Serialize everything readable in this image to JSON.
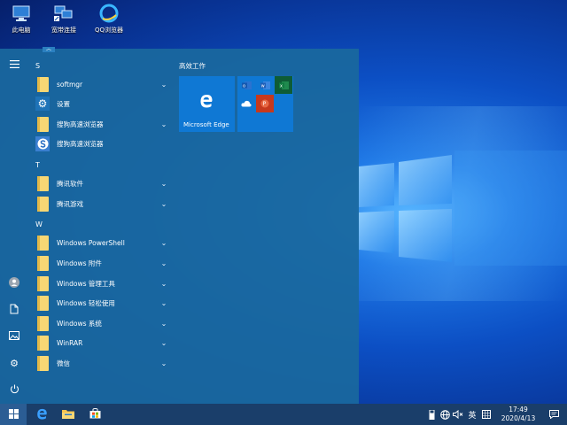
{
  "desktop": {
    "icons": [
      {
        "label": "此电脑",
        "icon": "computer-icon"
      },
      {
        "label": "宽带连接",
        "icon": "network-connection-icon"
      },
      {
        "label": "QQ浏览器",
        "icon": "qq-browser-icon"
      }
    ]
  },
  "start_menu": {
    "groups": [
      {
        "letter": "S",
        "apps": [
          {
            "label": "softmgr",
            "icon": "folder-icon",
            "expandable": true
          },
          {
            "label": "设置",
            "icon": "gear-icon",
            "expandable": false
          },
          {
            "label": "搜狗高速浏览器",
            "icon": "folder-icon",
            "expandable": true
          },
          {
            "label": "搜狗高速浏览器",
            "icon": "sogou-browser-icon",
            "expandable": false
          }
        ]
      },
      {
        "letter": "T",
        "apps": [
          {
            "label": "腾讯软件",
            "icon": "folder-icon",
            "expandable": true
          },
          {
            "label": "腾讯游戏",
            "icon": "folder-icon",
            "expandable": true
          }
        ]
      },
      {
        "letter": "W",
        "apps": [
          {
            "label": "Windows PowerShell",
            "icon": "folder-icon",
            "expandable": true
          },
          {
            "label": "Windows 附件",
            "icon": "folder-icon",
            "expandable": true
          },
          {
            "label": "Windows 管理工具",
            "icon": "folder-icon",
            "expandable": true
          },
          {
            "label": "Windows 轻松使用",
            "icon": "folder-icon",
            "expandable": true
          },
          {
            "label": "Windows 系统",
            "icon": "folder-icon",
            "expandable": true
          },
          {
            "label": "WinRAR",
            "icon": "folder-icon",
            "expandable": true
          },
          {
            "label": "微信",
            "icon": "folder-icon",
            "expandable": true
          }
        ]
      }
    ],
    "tiles": {
      "group_title": "高效工作",
      "edge_label": "Microsoft Edge"
    }
  },
  "taskbar": {
    "ime": "英",
    "time": "17:49",
    "date": "2020/4/13"
  },
  "colors": {
    "start_bg": "#1a689e",
    "tile_blue": "#0f78d4",
    "taskbar": "#1a3e6a",
    "folder": "#f7d774"
  }
}
